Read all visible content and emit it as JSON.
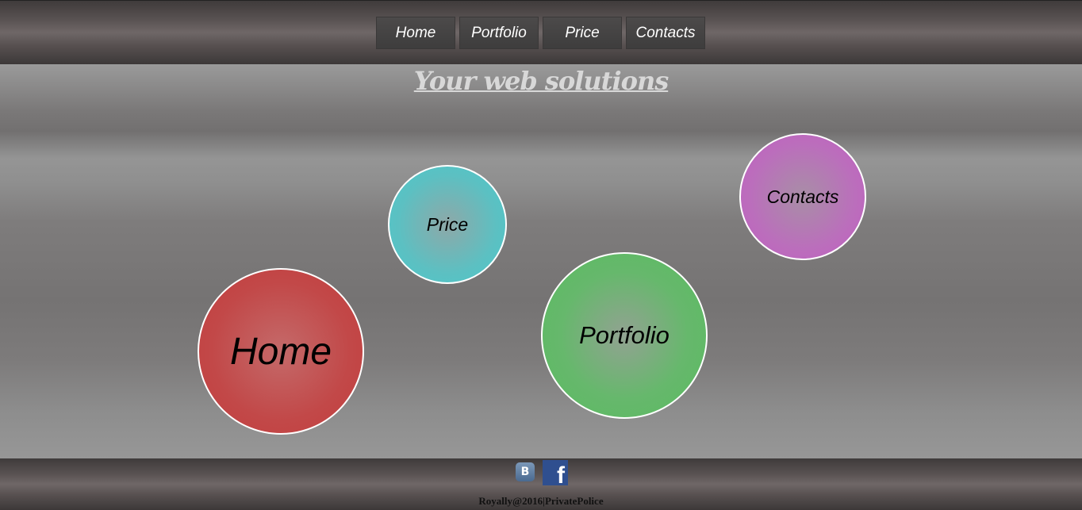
{
  "nav": {
    "items": [
      {
        "label": "Home"
      },
      {
        "label": "Portfolio"
      },
      {
        "label": "Price"
      },
      {
        "label": "Contacts"
      }
    ]
  },
  "main": {
    "tagline": "Your web solutions",
    "bubbles": {
      "home": "Home",
      "price": "Price",
      "portfolio": "Portfolio",
      "contacts": "Contacts"
    },
    "colors": {
      "home": "#c24848",
      "price": "#4cc8ca",
      "portfolio": "#5abb60",
      "contacts": "#c15ec1"
    }
  },
  "footer": {
    "social": {
      "vk_icon": "vk-icon",
      "vk_glyph": "B",
      "facebook_icon": "facebook-icon",
      "facebook_glyph": "f"
    },
    "copyright": "Royally@2016|PrivatePolice"
  }
}
